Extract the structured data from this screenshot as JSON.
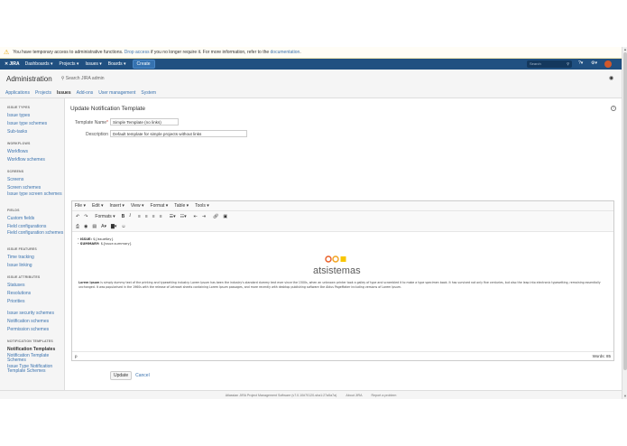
{
  "warning": {
    "text_before": "You have temporary access to administrative functions.",
    "drop_link": "Drop access",
    "text_middle": "if you no longer require it. For more information, refer to the",
    "doc_link": "documentation",
    "text_end": "."
  },
  "topnav": {
    "logo": "JIRA",
    "items": [
      "Dashboards ▾",
      "Projects ▾",
      "Issues ▾",
      "Boards ▾"
    ],
    "create": "Create",
    "search_placeholder": "Search"
  },
  "admin": {
    "title": "Administration",
    "search": "Search JIRA admin"
  },
  "tabs": [
    "Applications",
    "Projects",
    "Issues",
    "Add-ons",
    "User management",
    "System"
  ],
  "sidebar": {
    "sections": [
      {
        "heading": "ISSUE TYPES",
        "items": [
          "Issue types",
          "Issue type schemes",
          "Sub-tasks"
        ]
      },
      {
        "heading": "WORKFLOWS",
        "items": [
          "Workflows",
          "Workflow schemes"
        ]
      },
      {
        "heading": "SCREENS",
        "items": [
          "Screens",
          "Screen schemes",
          "Issue type screen schemes"
        ]
      },
      {
        "heading": "FIELDS",
        "items": [
          "Custom fields",
          "Field configurations",
          "Field configuration schemes"
        ]
      },
      {
        "heading": "ISSUE FEATURES",
        "items": [
          "Time tracking",
          "Issue linking"
        ]
      },
      {
        "heading": "ISSUE ATTRIBUTES",
        "items": [
          "Statuses",
          "Resolutions",
          "Priorities"
        ]
      },
      {
        "heading": "",
        "items": [
          "Issue security schemes",
          "Notification schemes",
          "Permission schemes"
        ]
      },
      {
        "heading": "NOTIFICATION TEMPLATES",
        "items": [
          "Notification Templates",
          "Notification Template Schemes",
          "Issue Type Notification Template Schemes"
        ]
      }
    ]
  },
  "form": {
    "title": "Update Notification Template",
    "name_label": "Template Name",
    "name_value": "Simple Template (no links)",
    "desc_label": "Description",
    "desc_value": "Default template for simple projects without links"
  },
  "editor": {
    "menus": [
      "File ▾",
      "Edit ▾",
      "Insert ▾",
      "View ▾",
      "Format ▾",
      "Table ▾",
      "Tools ▾"
    ],
    "formats": "Formats ▾",
    "line1_label": "- ISSUE: ",
    "line1_var": "${issueKey}",
    "line2_label": "- SUMMARY: ",
    "line2_var": "${issue.summary}",
    "logo_text": "atsistemas",
    "lorem_bold": "Lorem Ipsum",
    "lorem": " is simply dummy text of the printing and typesetting industry. Lorem Ipsum has been the industry's standard dummy text ever since the 1500s, when an unknown printer took a galley of type and scrambled it to make a type specimen book. It has survived not only five centuries, but also the leap into electronic typesetting, remaining essentially unchanged. It was popularised in the 1960s with the release of Letraset sheets containing Lorem Ipsum passages, and more recently with desktop publishing software like Aldus PageMaker including versions of Lorem Ipsum.",
    "status_path": "p",
    "words": "Words: 85"
  },
  "actions": {
    "update": "Update",
    "cancel": "Cancel"
  },
  "footer": {
    "version": "Atlassian JIRA Project Management Software (v7.0.10#70120-sha1:27a5a7a)",
    "about": "About JIRA",
    "report": "Report a problem"
  }
}
